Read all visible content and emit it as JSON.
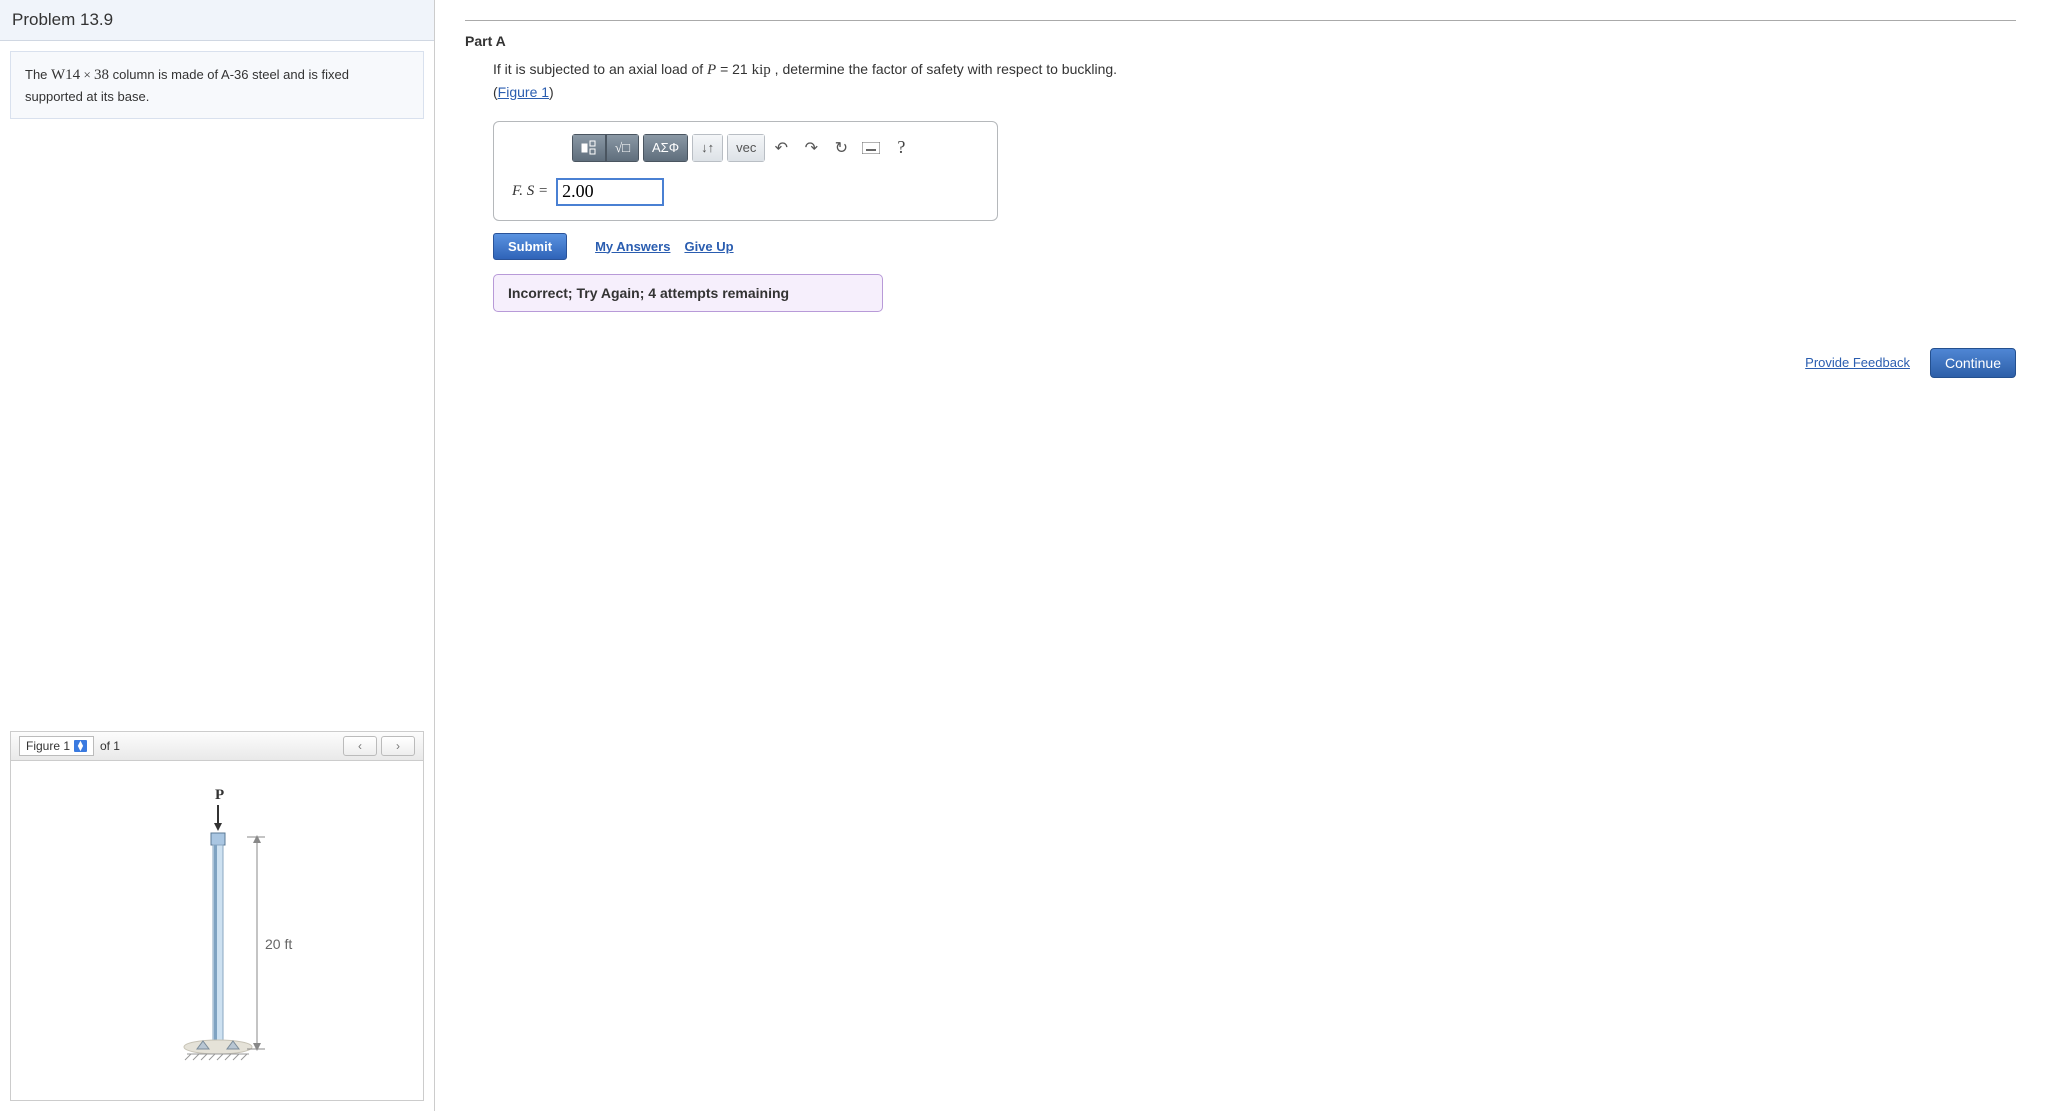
{
  "problem": {
    "title": "Problem 13.9",
    "desc_pre": "The ",
    "desc_w": "W14",
    "desc_x": " × ",
    "desc_num": "38",
    "desc_post": " column is made of A-36 steel and is fixed supported at its base."
  },
  "figure": {
    "select_label": "Figure 1",
    "of_label": "of 1",
    "load_label": "P",
    "height_label": "20 ft"
  },
  "partA": {
    "label": "Part A",
    "text_pre": "If it is subjected to an axial load of ",
    "P_sym": "P",
    "eq": " = 21 ",
    "unit": "kip",
    "text_post": " , determine the factor of safety with respect to buckling.",
    "figlink": "Figure 1"
  },
  "toolbar": {
    "greek": "ΑΣΦ",
    "vec": "vec"
  },
  "answer": {
    "label": "F. S = ",
    "value": "2.00"
  },
  "actions": {
    "submit": "Submit",
    "my_answers": "My Answers",
    "give_up": "Give Up"
  },
  "feedback": "Incorrect; Try Again; 4 attempts remaining",
  "footer": {
    "provide": "Provide Feedback",
    "continue": "Continue"
  }
}
